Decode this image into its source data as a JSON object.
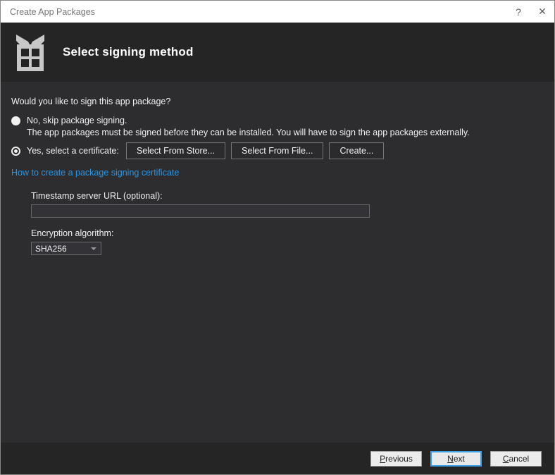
{
  "window": {
    "title": "Create App Packages",
    "help_glyph": "?",
    "close_glyph": "✕"
  },
  "header": {
    "title": "Select signing method",
    "icon": "gift-icon"
  },
  "content": {
    "question": "Would you like to sign this app package?",
    "radio_no_label": "No, skip package signing.",
    "radio_no_description": "The app packages must be signed before they can be installed. You will have to sign the app packages externally.",
    "radio_yes_label": "Yes, select a certificate:",
    "radio_selected": "yes",
    "select_from_store_label": "Select From Store...",
    "select_from_file_label": "Select From File...",
    "create_label": "Create...",
    "link_label": "How to create a package signing certificate",
    "timestamp_label": "Timestamp server URL (optional):",
    "timestamp_value": "",
    "encryption_label": "Encryption algorithm:",
    "encryption_selected": "SHA256"
  },
  "footer": {
    "previous": {
      "key": "P",
      "rest": "revious"
    },
    "next": {
      "key": "N",
      "rest": "ext"
    },
    "cancel": {
      "key": "C",
      "rest": "ancel"
    }
  },
  "colors": {
    "titlebar_bg": "#ffffff",
    "header_bg": "#252526",
    "content_bg": "#2d2d30",
    "footer_bg": "#252526",
    "text": "#f1f1f1",
    "link": "#2596e8",
    "focus_blue": "#3da0e3",
    "icon_gray": "#c8c8c8"
  }
}
